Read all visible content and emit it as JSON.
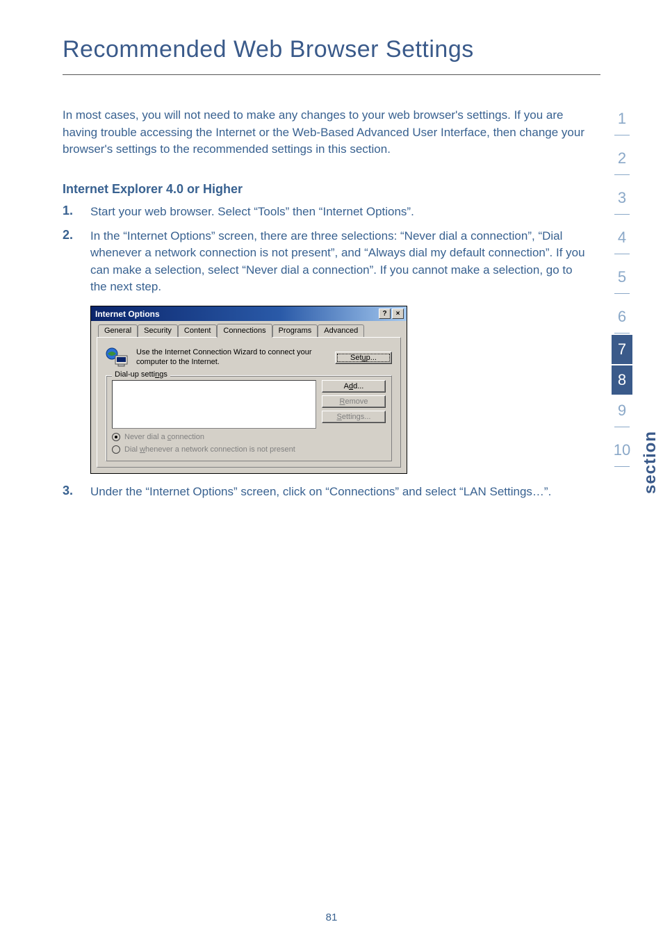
{
  "title": "Recommended Web Browser Settings",
  "intro": "In most cases, you will not need to make any changes to your web browser's settings. If you are having trouble accessing the Internet or the Web-Based Advanced User Interface, then change your browser's settings to the recommended settings in this section.",
  "subhead": "Internet Explorer 4.0 or Higher",
  "steps": {
    "s1_num": "1.",
    "s1_text": "Start your web browser. Select “Tools” then “Internet Options”.",
    "s2_num": "2.",
    "s2_text": "In the “Internet Options” screen, there are three selections: “Never dial a connection”, “Dial whenever a network connection is not present”, and “Always dial my default connection”. If you can make a selection, select “Never dial a connection”. If you cannot make a selection, go to the next step.",
    "s3_num": "3.",
    "s3_text": "Under the “Internet Options” screen, click on “Connections” and select “LAN Settings…”."
  },
  "dialog": {
    "title": "Internet Options",
    "help_btn": "?",
    "close_btn": "×",
    "tabs": {
      "general": "General",
      "security": "Security",
      "content": "Content",
      "connections": "Connections",
      "programs": "Programs",
      "advanced": "Advanced"
    },
    "wizard_text": "Use the Internet Connection Wizard to connect your computer to the Internet.",
    "setup_btn_pre": "Set",
    "setup_btn_u": "u",
    "setup_btn_post": "p...",
    "dialup_legend_pre": "Dial-up setti",
    "dialup_legend_u": "n",
    "dialup_legend_post": "gs",
    "add_btn_pre": "A",
    "add_btn_u": "d",
    "add_btn_post": "d...",
    "remove_btn_pre": "",
    "remove_btn_u": "R",
    "remove_btn_post": "emove",
    "settings_btn_pre": "",
    "settings_btn_u": "S",
    "settings_btn_post": "ettings...",
    "radio_never_pre": "Never dial a ",
    "radio_never_u": "c",
    "radio_never_post": "onnection",
    "radio_dial_pre": "Dial ",
    "radio_dial_u": "w",
    "radio_dial_post": "henever a network connection is not present"
  },
  "sidenav": {
    "n1": "1",
    "n2": "2",
    "n3": "3",
    "n4": "4",
    "n5": "5",
    "n6": "6",
    "n7": "7",
    "n8": "8",
    "n9": "9",
    "n10": "10"
  },
  "section_label": "section",
  "page_number": "81"
}
